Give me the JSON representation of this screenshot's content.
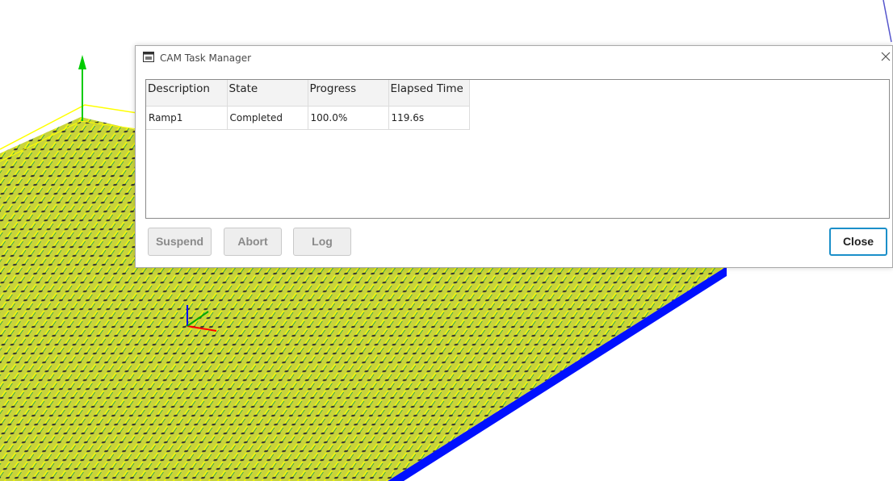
{
  "dialog": {
    "title": "CAM Task Manager",
    "table": {
      "columns": [
        "Description",
        "State",
        "Progress",
        "Elapsed Time"
      ],
      "rows": [
        {
          "description": "Ramp1",
          "state": "Completed",
          "progress": "100.0%",
          "elapsed": "119.6s"
        }
      ]
    },
    "buttons": {
      "suspend": "Suspend",
      "abort": "Abort",
      "log": "Log",
      "close": "Close"
    }
  },
  "colors": {
    "accent": "#1b8fc9",
    "plate_blue": "#0010ff",
    "toolpath_yellow": "#ffff00"
  },
  "icons": {
    "app": "cam-task-manager-icon",
    "close": "close-icon"
  }
}
